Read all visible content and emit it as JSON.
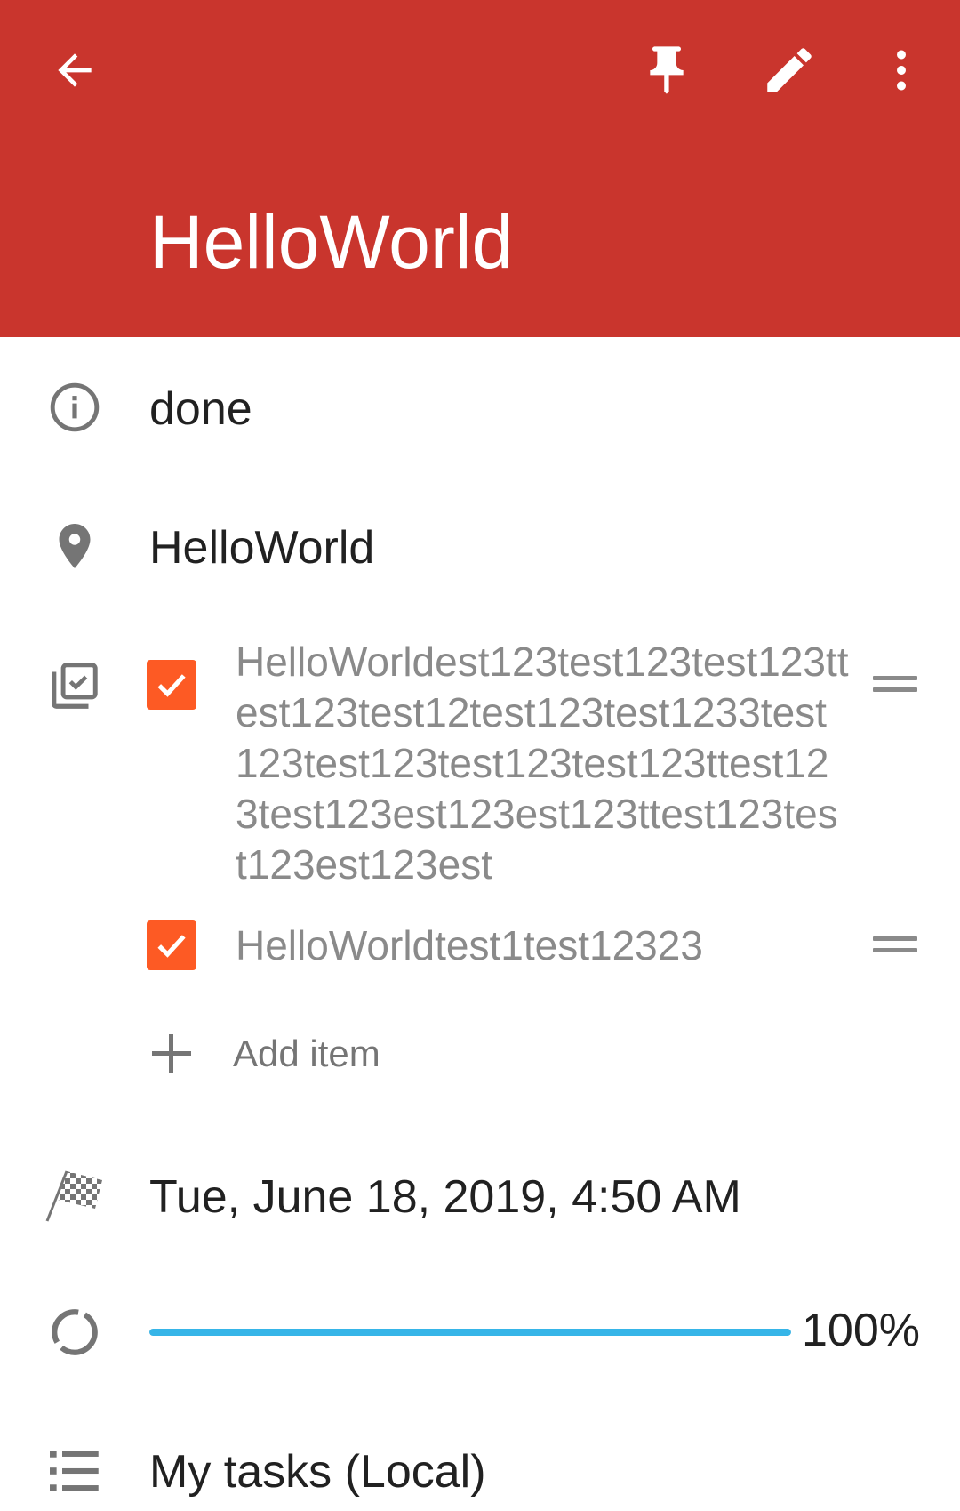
{
  "app_bar": {
    "title": "HelloWorld",
    "color": "#c9352d",
    "icons": [
      "back-arrow-icon",
      "pin-icon",
      "edit-pencil-icon",
      "more-vert-icon"
    ]
  },
  "status": {
    "icon": "info-icon",
    "text": "done"
  },
  "location": {
    "icon": "location-pin-icon",
    "text": "HelloWorld"
  },
  "checklist": {
    "icon": "checklist-icon",
    "items": [
      {
        "checked": true,
        "text": "HelloWorldest123test123test123ttest123test12test123test1233test123test123test123test123ttest123test123est123est123ttest123test123est123est"
      },
      {
        "checked": true,
        "text": "HelloWorldtest1test12323"
      }
    ],
    "add_label": "Add item",
    "checkbox_color": "#fd5a24"
  },
  "due": {
    "icon": "checkered-flag-icon",
    "text": "Tue, June 18, 2019, 4:50 AM"
  },
  "progress": {
    "icon": "progress-circle-icon",
    "value": 100,
    "label": "100%",
    "color": "#36b5e8"
  },
  "list": {
    "icon": "list-icon",
    "text": "My tasks (Local)"
  }
}
